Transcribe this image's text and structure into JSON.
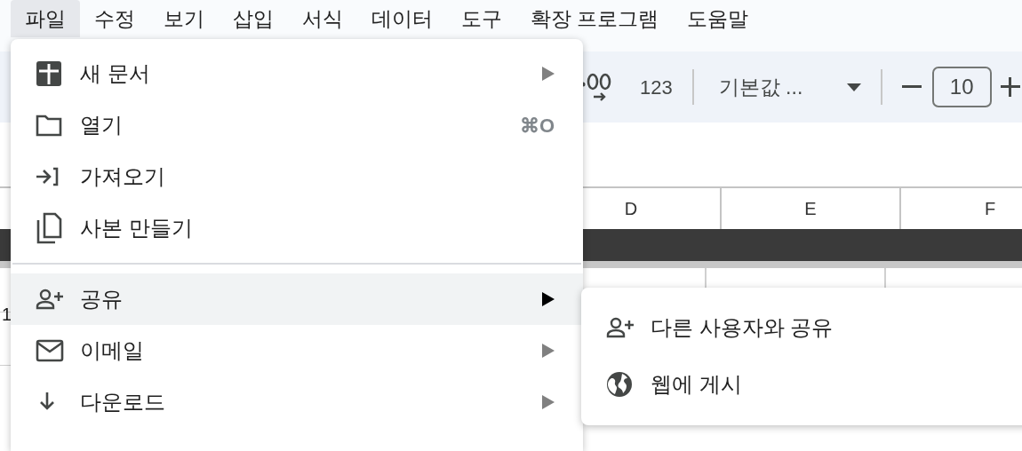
{
  "menubar": [
    {
      "label": "파일",
      "selected": true
    },
    {
      "label": "수정",
      "selected": false
    },
    {
      "label": "보기",
      "selected": false
    },
    {
      "label": "삽입",
      "selected": false
    },
    {
      "label": "서식",
      "selected": false
    },
    {
      "label": "데이터",
      "selected": false
    },
    {
      "label": "도구",
      "selected": false
    },
    {
      "label": "확장 프로그램",
      "selected": false
    },
    {
      "label": "도움말",
      "selected": false
    }
  ],
  "toolbar": {
    "number_format": "123",
    "font": "기본값 ...",
    "font_size": "10"
  },
  "columns": [
    "D",
    "E",
    "F"
  ],
  "row_numbers": [
    "1"
  ],
  "file_menu": [
    {
      "kind": "item",
      "label": "새 문서",
      "submenu": true,
      "selected": false
    },
    {
      "kind": "item",
      "label": "열기",
      "shortcut": "⌘O",
      "selected": false
    },
    {
      "kind": "item",
      "label": "가져오기",
      "selected": false
    },
    {
      "kind": "item",
      "label": "사본 만들기",
      "selected": false
    },
    {
      "kind": "divider"
    },
    {
      "kind": "item",
      "label": "공유",
      "submenu": true,
      "selected": true
    },
    {
      "kind": "item",
      "label": "이메일",
      "submenu": true,
      "selected": false
    },
    {
      "kind": "item",
      "label": "다운로드",
      "submenu": true,
      "selected": false
    }
  ],
  "share_submenu": [
    {
      "label": "다른 사용자와 공유"
    },
    {
      "label": "웹에 게시"
    }
  ]
}
